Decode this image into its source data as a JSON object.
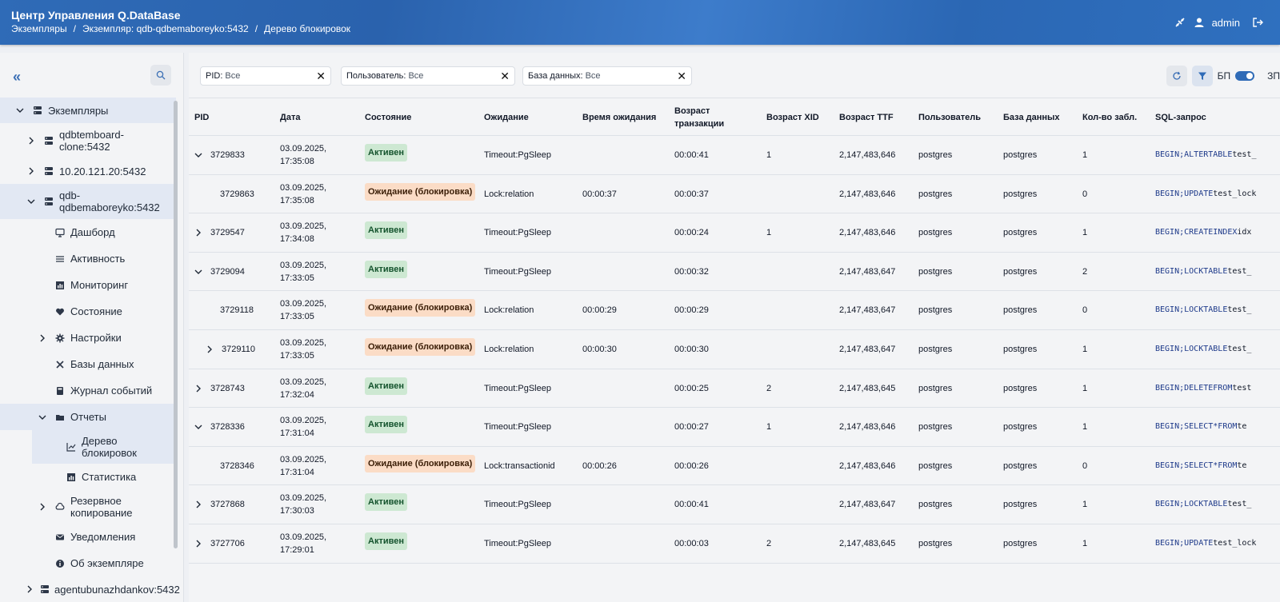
{
  "header": {
    "title": "Центр Управления Q.DataBase",
    "breadcrumbs": [
      "Экземпляры",
      "/",
      "Экземпляр: qdb-qdbemaboreyko:5432",
      "/",
      "Дерево блокировок"
    ],
    "user": "admin"
  },
  "sidebar": {
    "collapse_label": "«",
    "items": [
      {
        "label": "Экземпляры",
        "icon": "server-icon"
      },
      {
        "label": "qdbtemboard-clone:5432",
        "icon": "server-icon"
      },
      {
        "label": "10.20.121.20:5432",
        "icon": "server-icon"
      },
      {
        "label": "qdb-qdbemaboreyko:5432",
        "icon": "server-icon"
      },
      {
        "label": "Дашборд",
        "icon": "monitor-icon"
      },
      {
        "label": "Активность",
        "icon": "list-icon"
      },
      {
        "label": "Мониторинг",
        "icon": "chart-icon"
      },
      {
        "label": "Состояние",
        "icon": "heart-icon"
      },
      {
        "label": "Настройки",
        "icon": "gear-icon"
      },
      {
        "label": "Базы данных",
        "icon": "tools-icon"
      },
      {
        "label": "Журнал событий",
        "icon": "book-icon"
      },
      {
        "label": "Отчеты",
        "icon": "folder-icon"
      },
      {
        "label": "Дерево блокировок",
        "icon": "tree-chart-icon"
      },
      {
        "label": "Статистика",
        "icon": "chart-icon"
      },
      {
        "label": "Резервное копирование",
        "icon": "cloud-icon"
      },
      {
        "label": "Уведомления",
        "icon": "mail-icon"
      },
      {
        "label": "Об экземпляре",
        "icon": "info-icon"
      },
      {
        "label": "agentubunazhdankov:5432",
        "icon": "server-icon"
      }
    ]
  },
  "filters": [
    {
      "label": "PID:",
      "value": "Все"
    },
    {
      "label": "Пользователь:",
      "value": "Все"
    },
    {
      "label": "База данных:",
      "value": "Все"
    }
  ],
  "toolbar": {
    "bp": "БП",
    "zp": "ЗП"
  },
  "table": {
    "headers": [
      "PID",
      "Дата",
      "Состояние",
      "Ожидание",
      "Время ожидания",
      "Возраст транзакции",
      "Возраст XID",
      "Возраст TTF",
      "Пользователь",
      "База данных",
      "Кол-во забл.",
      "SQL-запрос"
    ],
    "rows": [
      {
        "pid": "3729833",
        "date": "03.09.2025, 17:35:08",
        "state": "Активен",
        "wait": "Timeout:PgSleep",
        "wait_time": "",
        "xact_age": "00:00:41",
        "xid_age": "1",
        "ttf_age": "2,147,483,646",
        "user": "postgres",
        "db": "postgres",
        "locks": "1",
        "sql": "BEGIN; ALTER TABLE test_"
      },
      {
        "pid": "3729863",
        "date": "03.09.2025, 17:35:08",
        "state": "Ожидание (блокировка)",
        "wait": "Lock:relation",
        "wait_time": "00:00:37",
        "xact_age": "00:00:37",
        "xid_age": "",
        "ttf_age": "2,147,483,646",
        "user": "postgres",
        "db": "postgres",
        "locks": "0",
        "sql": "BEGIN; UPDATE test_lock"
      },
      {
        "pid": "3729547",
        "date": "03.09.2025, 17:34:08",
        "state": "Активен",
        "wait": "Timeout:PgSleep",
        "wait_time": "",
        "xact_age": "00:00:24",
        "xid_age": "1",
        "ttf_age": "2,147,483,646",
        "user": "postgres",
        "db": "postgres",
        "locks": "1",
        "sql": "BEGIN; CREATE INDEX idx"
      },
      {
        "pid": "3729094",
        "date": "03.09.2025, 17:33:05",
        "state": "Активен",
        "wait": "Timeout:PgSleep",
        "wait_time": "",
        "xact_age": "00:00:32",
        "xid_age": "",
        "ttf_age": "2,147,483,647",
        "user": "postgres",
        "db": "postgres",
        "locks": "2",
        "sql": "BEGIN; LOCK TABLE test_"
      },
      {
        "pid": "3729118",
        "date": "03.09.2025, 17:33:05",
        "state": "Ожидание (блокировка)",
        "wait": "Lock:relation",
        "wait_time": "00:00:29",
        "xact_age": "00:00:29",
        "xid_age": "",
        "ttf_age": "2,147,483,647",
        "user": "postgres",
        "db": "postgres",
        "locks": "0",
        "sql": "BEGIN; LOCK TABLE test_"
      },
      {
        "pid": "3729110",
        "date": "03.09.2025, 17:33:05",
        "state": "Ожидание (блокировка)",
        "wait": "Lock:relation",
        "wait_time": "00:00:30",
        "xact_age": "00:00:30",
        "xid_age": "",
        "ttf_age": "2,147,483,647",
        "user": "postgres",
        "db": "postgres",
        "locks": "1",
        "sql": "BEGIN; LOCK TABLE test_"
      },
      {
        "pid": "3728743",
        "date": "03.09.2025, 17:32:04",
        "state": "Активен",
        "wait": "Timeout:PgSleep",
        "wait_time": "",
        "xact_age": "00:00:25",
        "xid_age": "2",
        "ttf_age": "2,147,483,645",
        "user": "postgres",
        "db": "postgres",
        "locks": "1",
        "sql": "BEGIN; DELETE FROM test"
      },
      {
        "pid": "3728336",
        "date": "03.09.2025, 17:31:04",
        "state": "Активен",
        "wait": "Timeout:PgSleep",
        "wait_time": "",
        "xact_age": "00:00:27",
        "xid_age": "1",
        "ttf_age": "2,147,483,646",
        "user": "postgres",
        "db": "postgres",
        "locks": "1",
        "sql": "BEGIN; SELECT * FROM te"
      },
      {
        "pid": "3728346",
        "date": "03.09.2025, 17:31:04",
        "state": "Ожидание (блокировка)",
        "wait": "Lock:transactionid",
        "wait_time": "00:00:26",
        "xact_age": "00:00:26",
        "xid_age": "",
        "ttf_age": "2,147,483,646",
        "user": "postgres",
        "db": "postgres",
        "locks": "0",
        "sql": "BEGIN; SELECT * FROM te"
      },
      {
        "pid": "3727868",
        "date": "03.09.2025, 17:30:03",
        "state": "Активен",
        "wait": "Timeout:PgSleep",
        "wait_time": "",
        "xact_age": "00:00:41",
        "xid_age": "",
        "ttf_age": "2,147,483,647",
        "user": "postgres",
        "db": "postgres",
        "locks": "1",
        "sql": "BEGIN; LOCK TABLE test_"
      },
      {
        "pid": "3727706",
        "date": "03.09.2025, 17:29:01",
        "state": "Активен",
        "wait": "Timeout:PgSleep",
        "wait_time": "",
        "xact_age": "00:00:03",
        "xid_age": "2",
        "ttf_age": "2,147,483,645",
        "user": "postgres",
        "db": "postgres",
        "locks": "1",
        "sql": "BEGIN; UPDATE test_lock"
      }
    ]
  },
  "colors": {
    "header_blue": "#2f6bb7",
    "active_badge": "#cde8d2",
    "wait_badge": "#fbdcc6",
    "sql_keyword": "#1e3a8a"
  }
}
